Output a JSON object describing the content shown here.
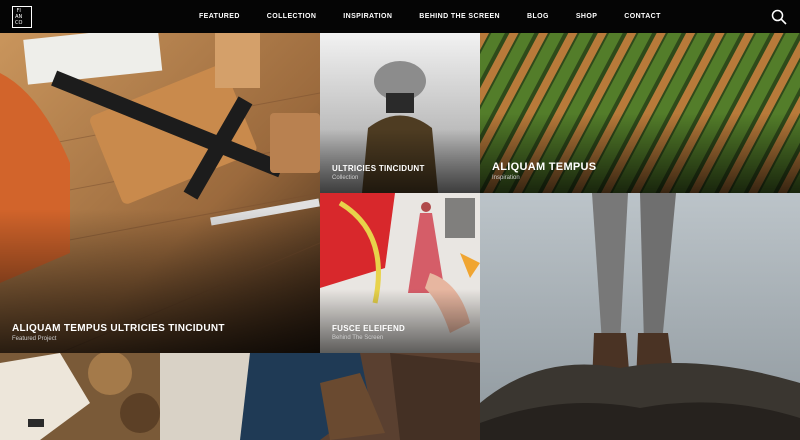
{
  "logo": {
    "letters": [
      "FI",
      "AN",
      "CO"
    ]
  },
  "nav": {
    "items": [
      {
        "label": "FEATURED"
      },
      {
        "label": "COLLECTION"
      },
      {
        "label": "INSPIRATION"
      },
      {
        "label": "BEHIND THE SCREEN"
      },
      {
        "label": "BLOG"
      },
      {
        "label": "SHOP"
      },
      {
        "label": "CONTACT"
      }
    ]
  },
  "tiles": {
    "featured": {
      "title": "ALIQUAM TEMPUS ULTRICIES TINCIDUNT",
      "subtitle": "Featured Project"
    },
    "collection": {
      "title": "ULTRICIES TINCIDUNT",
      "subtitle": "Collection"
    },
    "inspiration": {
      "title": "ALIQUAM TEMPUS",
      "subtitle": "Inspiration"
    },
    "behind": {
      "title": "FUSCE ELEIFEND",
      "subtitle": "Behind The Screen"
    }
  }
}
